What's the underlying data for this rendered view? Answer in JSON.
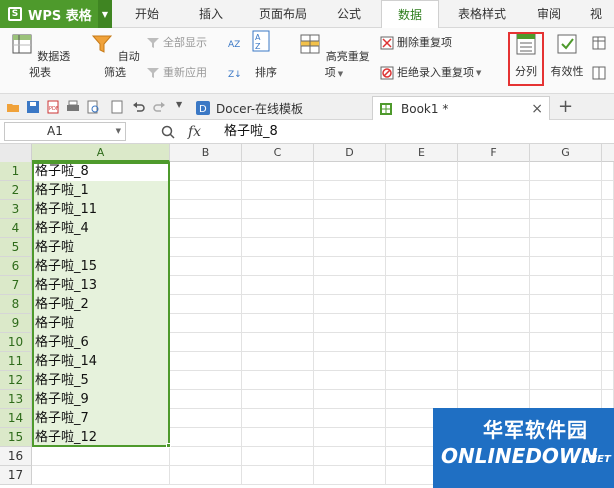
{
  "app": {
    "name": "WPS 表格",
    "logo_letter": "S"
  },
  "menu": {
    "tabs": [
      "开始",
      "插入",
      "页面布局",
      "公式",
      "数据",
      "表格样式",
      "审阅",
      "视"
    ],
    "active": "数据"
  },
  "ribbon": {
    "pivot_label": "数据透视表",
    "autofilter_label": "自动筛选",
    "show_all_label": "全部显示",
    "reapply_label": "重新应用",
    "sort_label": "排序",
    "highlight_dup_label": "高亮重复项",
    "remove_dup_label": "删除重复项",
    "reject_dup_label": "拒绝录入重复项",
    "split_label": "分列",
    "validity_label": "有效性"
  },
  "doc_tabs": {
    "docer_label": "Docer-在线模板",
    "book_label": "Book1 *",
    "close_symbol": "×",
    "add_symbol": "+"
  },
  "formula_bar": {
    "cell_ref": "A1",
    "fx_label": "fx",
    "value": "格子啦_8"
  },
  "sheet": {
    "columns": [
      "A",
      "B",
      "C",
      "D",
      "E",
      "F",
      "G"
    ],
    "rows": [
      "1",
      "2",
      "3",
      "4",
      "5",
      "6",
      "7",
      "8",
      "9",
      "10",
      "11",
      "12",
      "13",
      "14",
      "15",
      "16",
      "17"
    ],
    "column_a": [
      "格子啦_8",
      "格子啦_1",
      "格子啦_11",
      "格子啦_4",
      "格子啦",
      "格子啦_15",
      "格子啦_13",
      "格子啦_2",
      "格子啦",
      "格子啦_6",
      "格子啦_14",
      "格子啦_5",
      "格子啦_9",
      "格子啦_7",
      "格子啦_12",
      "",
      ""
    ]
  },
  "watermark": {
    "cn": "华军软件园",
    "en": "ONLINEDOWN",
    "net": ".NET"
  },
  "colors": {
    "brand_green": "#4e9a2c",
    "highlight_red": "#e53333",
    "watermark_blue": "#1f6fc3"
  }
}
